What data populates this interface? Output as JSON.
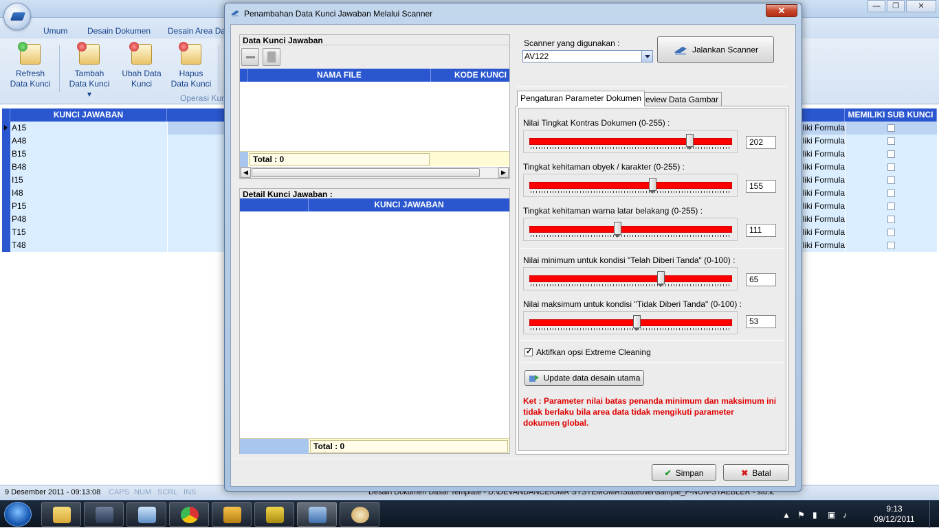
{
  "app": {
    "ribbon_tabs": [
      "Umum",
      "Desain Dokumen",
      "Desain Area Dat"
    ],
    "ribbon_buttons": [
      {
        "line1": "Refresh",
        "line2": "Data Kunci"
      },
      {
        "line1": "Tambah",
        "line2": "Data Kunci ▾"
      },
      {
        "line1": "Ubah Data",
        "line2": "Kunci"
      },
      {
        "line1": "Hapus",
        "line2": "Data Kunci"
      }
    ],
    "group_label": "Operasi Kun",
    "grid": {
      "col_kunci": "KUNCI JAWABAN",
      "col_sub": "MEMILIKI SUB KUNCI",
      "formula_text": "iliki Formula",
      "rows": [
        "A15",
        "A48",
        "B15",
        "B48",
        "I15",
        "I48",
        "P15",
        "P48",
        "T15",
        "T48"
      ]
    },
    "status": {
      "datetime": "9 Desember 2011 - 09:13:08",
      "caps": "CAPS",
      "num": "NUM",
      "scrl": "SCRL",
      "ins": "INS",
      "doc_path": "Desain Dokumen Dasar Template - D:\\DEVANDANCEIOMR SYSTEMOMR\\Stateolier\\sample_F-NON-STAEBLER - std.iodd"
    }
  },
  "taskbar": {
    "clock_time": "9:13",
    "clock_date": "09/12/2011"
  },
  "dialog": {
    "title": "Penambahan Data Kunci Jawaban Melalui Scanner",
    "close_label": "✕",
    "data_kunci": {
      "title": "Data Kunci Jawaban",
      "col_nama_file": "NAMA FILE",
      "col_kode_kunci": "KODE KUNCI",
      "total": "Total : 0"
    },
    "detail": {
      "title": "Detail Kunci Jawaban :",
      "col_kunci": "KUNCI JAWABAN",
      "total": "Total : 0"
    },
    "scanner": {
      "label": "Scanner yang digunakan :",
      "value": "AV122",
      "run_button": "Jalankan Scanner"
    },
    "tabs": [
      "Pengaturan Parameter Dokumen",
      "Preview Data Gambar"
    ],
    "params": [
      {
        "label": "Nilai Tingkat Kontras Dokumen (0-255) :",
        "value": "202",
        "min": 0,
        "max": 255
      },
      {
        "label": "Tingkat kehitaman obyek / karakter (0-255) :",
        "value": "155",
        "min": 0,
        "max": 255
      },
      {
        "label": "Tingkat kehitaman warna latar belakang (0-255) :",
        "value": "111",
        "min": 0,
        "max": 255
      },
      {
        "label": "Nilai minimum untuk kondisi \"Telah Diberi Tanda\" (0-100) :",
        "value": "65",
        "min": 0,
        "max": 100
      },
      {
        "label": "Nilai maksimum untuk kondisi \"Tidak Diberi Tanda\" (0-100) :",
        "value": "53",
        "min": 0,
        "max": 100
      }
    ],
    "extreme_cleaning": "Aktifkan opsi Extreme Cleaning",
    "update_button": "Update data desain utama",
    "note_lines": [
      "Ket : Parameter nilai batas penanda minimum   dan maksimum ini",
      "tidak berlaku bila area data tidak mengikuti parameter",
      "dokumen global."
    ],
    "save_button": "Simpan",
    "cancel_button": "Batal"
  },
  "colors": {
    "grid_header": "#2a57d0",
    "slider_track": "#ff0000",
    "note_text": "#e00000"
  }
}
